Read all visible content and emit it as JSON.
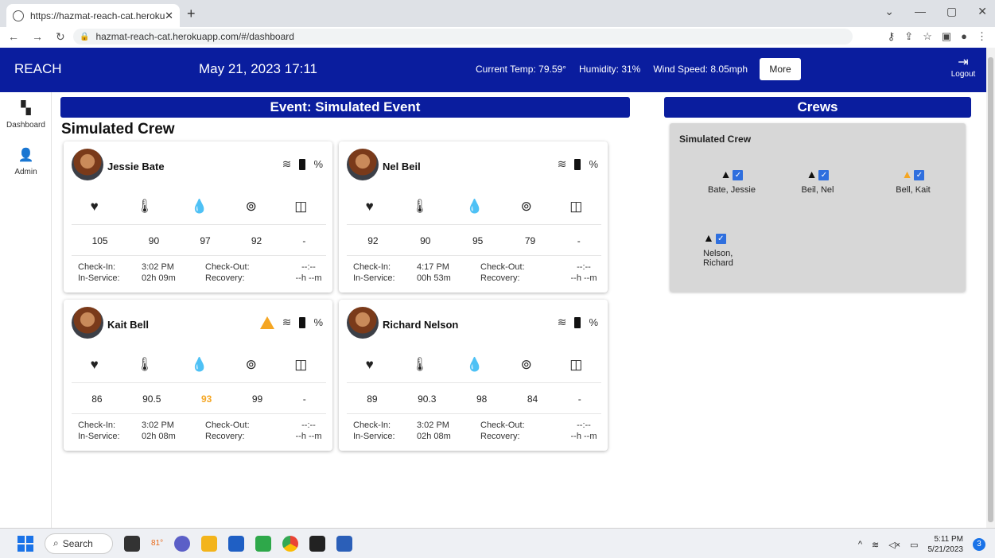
{
  "browser": {
    "tab_title": "https://hazmat-reach-cat.herokuapp.com/#/dashboard",
    "url": "hazmat-reach-cat.herokuapp.com/#/dashboard"
  },
  "header": {
    "brand": "REACH",
    "datetime": "May 21, 2023  17:11",
    "temp": "Current Temp: 79.59°",
    "humidity": "Humidity: 31%",
    "wind": "Wind Speed: 8.05mph",
    "more_label": "More",
    "logout_label": "Logout"
  },
  "sidebar": {
    "items": [
      {
        "label": "Dashboard",
        "icon": "dashboard-icon"
      },
      {
        "label": "Admin",
        "icon": "admin-icon"
      }
    ]
  },
  "event": {
    "title": "Event: Simulated Event",
    "crew_name": "Simulated Crew",
    "percent_symbol": "%",
    "labels": {
      "check_in": "Check-In:",
      "check_out": "Check-Out:",
      "in_service": "In-Service:",
      "recovery": "Recovery:"
    },
    "members": [
      {
        "name": "Jessie Bate",
        "warning": false,
        "hr": "105",
        "temp": "90",
        "o2": "97",
        "bp": "92",
        "resp": "-",
        "o2_warn": false,
        "check_in": "3:02 PM",
        "check_out": "--:--",
        "in_service": "02h 09m",
        "recovery": "--h --m"
      },
      {
        "name": "Nel Beil",
        "warning": false,
        "hr": "92",
        "temp": "90",
        "o2": "95",
        "bp": "79",
        "resp": "-",
        "o2_warn": false,
        "check_in": "4:17 PM",
        "check_out": "--:--",
        "in_service": "00h 53m",
        "recovery": "--h --m"
      },
      {
        "name": "Kait Bell",
        "warning": true,
        "hr": "86",
        "temp": "90.5",
        "o2": "93",
        "bp": "99",
        "resp": "-",
        "o2_warn": true,
        "check_in": "3:02 PM",
        "check_out": "--:--",
        "in_service": "02h 08m",
        "recovery": "--h --m"
      },
      {
        "name": "Richard Nelson",
        "warning": false,
        "hr": "89",
        "temp": "90.3",
        "o2": "98",
        "bp": "84",
        "resp": "-",
        "o2_warn": false,
        "check_in": "3:02 PM",
        "check_out": "--:--",
        "in_service": "02h 08m",
        "recovery": "--h --m"
      }
    ]
  },
  "crews": {
    "title": "Crews",
    "crew_name": "Simulated Crew",
    "members": [
      {
        "label": "Bate, Jessie",
        "status_color": "#111111"
      },
      {
        "label": "Beil, Nel",
        "status_color": "#111111"
      },
      {
        "label": "Bell, Kait",
        "status_color": "#f5a623"
      },
      {
        "label": "Nelson,\nRichard",
        "status_color": "#111111"
      }
    ]
  },
  "taskbar": {
    "search_label": "Search",
    "weather_badge": "81°",
    "time": "5:11 PM",
    "date": "5/21/2023",
    "notifications": "3"
  },
  "colors": {
    "brand_blue": "#0a1d9e",
    "warning": "#f5a623",
    "checkbox": "#2f6fde"
  }
}
